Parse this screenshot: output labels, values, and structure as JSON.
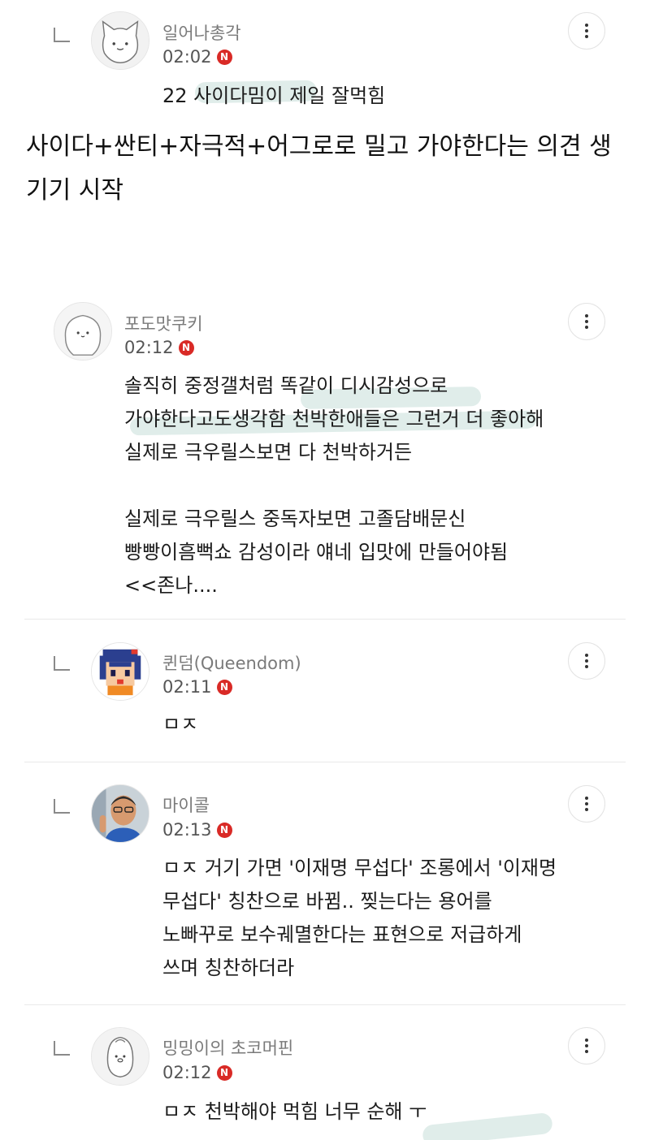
{
  "comments": [
    {
      "nickname": "일어나총각",
      "time": "02:02",
      "badge": "N",
      "body": "22 사이다밈이 제일 잘먹힘"
    },
    {
      "nickname": "포도맛쿠키",
      "time": "02:12",
      "badge": "N",
      "body": "솔직히 중정갤처럼 똑같이 디시감성으로\n가야한다고도생각함 천박한애들은 그런거 더 좋아해\n실제로 극우릴스보면 다 천박하거든\n\n실제로 극우릴스 중독자보면 고졸담배문신\n빵빵이흠뻑쇼 감성이라 얘네 입맛에 만들어야됨\n<<존나...."
    },
    {
      "nickname": "퀸덤(Queendom)",
      "time": "02:11",
      "badge": "N",
      "body": "ㅁㅈ"
    },
    {
      "nickname": "마이콜",
      "time": "02:13",
      "badge": "N",
      "body": "ㅁㅈ 거기 가면 '이재명 무섭다' 조롱에서 '이재명\n무섭다' 칭찬으로 바뀜.. 찢는다는 용어를\n노빠꾸로 보수궤멸한다는 표현으로 저급하게\n쓰며 칭찬하더라"
    },
    {
      "nickname": "밍밍이의 초코머핀",
      "time": "02:12",
      "badge": "N",
      "body": "ㅁㅈ 천박해야 먹힘 너무 순해 ㅜ"
    }
  ],
  "caption": "사이다+싼티+자극적+어그로로 밀고 가야한다는 의견 생\n기기 시작",
  "icons": {
    "reply": "reply-arrow-icon",
    "more": "more-vertical-icon",
    "badge": "new-badge-icon"
  },
  "colors": {
    "badge": "#d92a26",
    "highlight": "#8fbfb2"
  }
}
